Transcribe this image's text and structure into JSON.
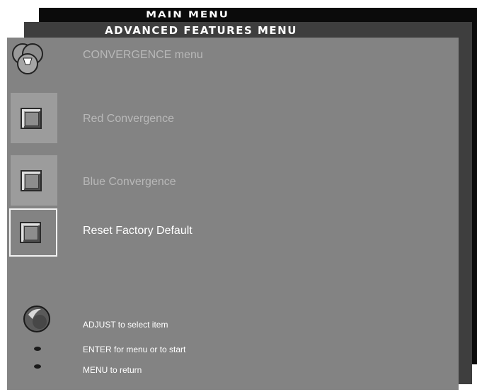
{
  "menus": {
    "main_title": "MAIN MENU",
    "advanced_title": "ADVANCED FEATURES MENU"
  },
  "convergence": {
    "header_label": "CONVERGENCE menu",
    "items": [
      {
        "label": "Red Convergence",
        "icon": "square-icon",
        "selected": false
      },
      {
        "label": "Blue Convergence",
        "icon": "square-icon",
        "selected": false
      },
      {
        "label": "Reset Factory Default",
        "icon": "square-icon",
        "selected": true
      }
    ]
  },
  "help": {
    "adjust": "ADJUST to select item",
    "enter": "ENTER for menu or to start",
    "menu": "MENU to return"
  },
  "colors": {
    "main_panel": "#0b0b0b",
    "advanced_panel": "#3e3e3e",
    "convergence_panel": "#838383",
    "dim_text": "#b8b8b8",
    "highlight_text": "#ffffff"
  }
}
